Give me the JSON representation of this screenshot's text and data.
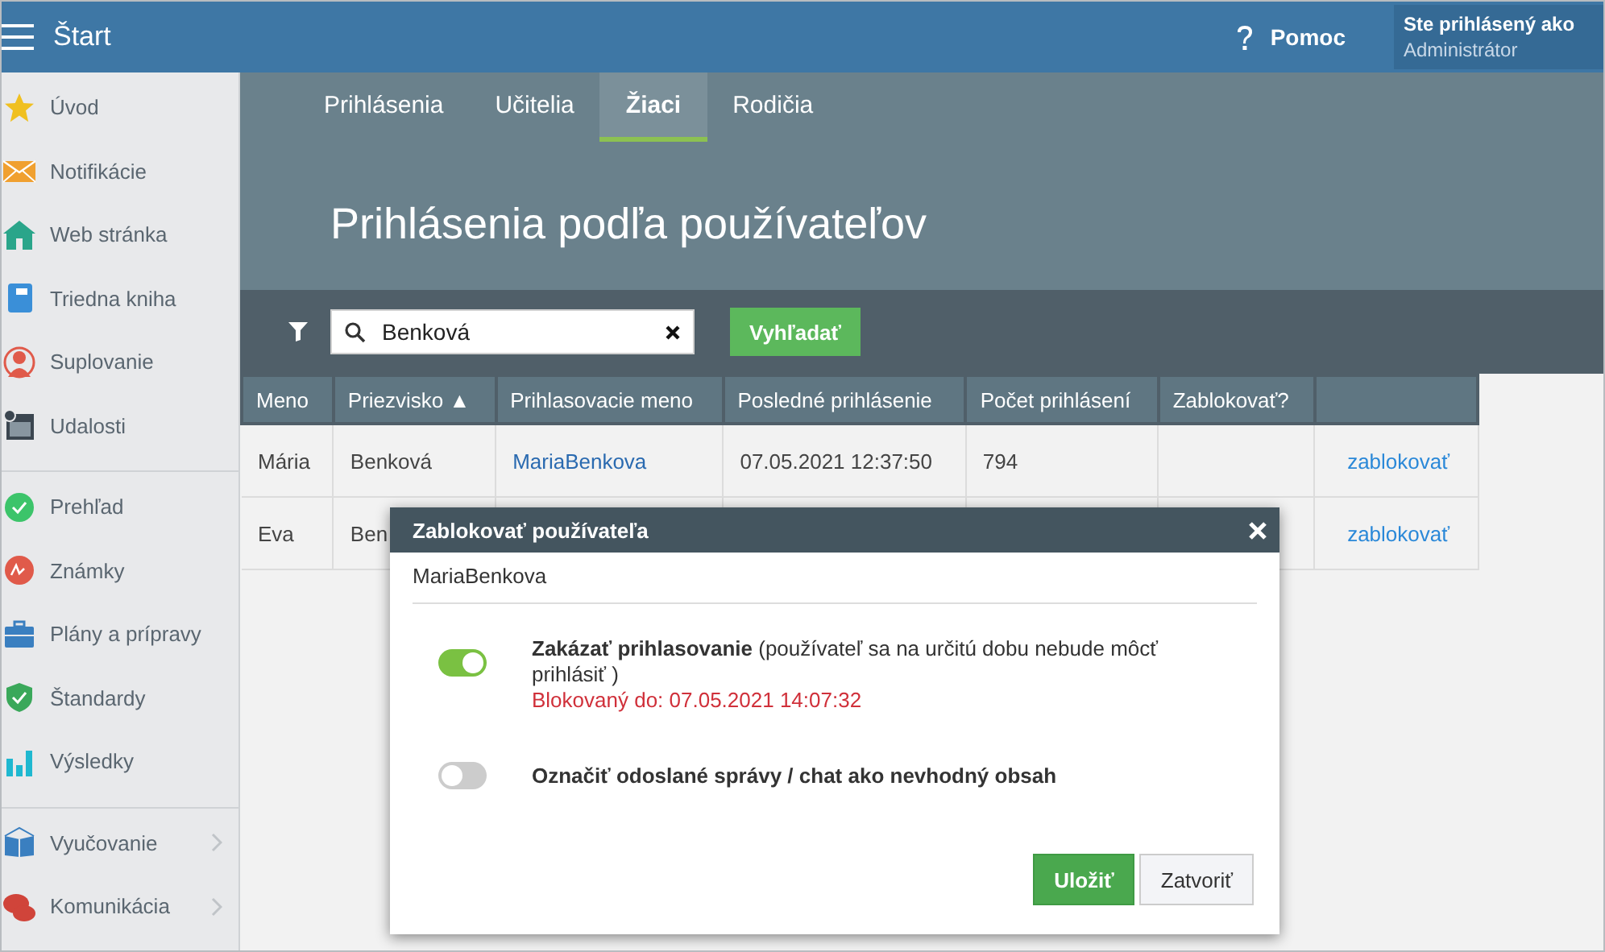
{
  "topbar": {
    "menu_label": "Štart",
    "help": "Pomoc",
    "user_caption": "Ste prihlásený ako",
    "user_role": "Administrátor"
  },
  "sidebar": {
    "groups": [
      {
        "items": [
          {
            "kind": "star",
            "label": "Úvod",
            "expandable": false
          },
          {
            "kind": "envelope",
            "label": "Notifikácie",
            "expandable": false
          },
          {
            "kind": "house",
            "label": "Web stránka",
            "expandable": false
          },
          {
            "kind": "notebook",
            "label": "Triedna kniha",
            "expandable": false
          },
          {
            "kind": "person",
            "label": "Suplovanie",
            "expandable": false
          },
          {
            "kind": "calendar",
            "label": "Udalosti",
            "expandable": false
          }
        ]
      },
      {
        "items": [
          {
            "kind": "check",
            "label": "Prehľad",
            "expandable": false
          },
          {
            "kind": "grade",
            "label": "Známky",
            "expandable": false
          },
          {
            "kind": "briefcase",
            "label": "Plány a prípravy",
            "expandable": false
          },
          {
            "kind": "shield",
            "label": "Štandardy",
            "expandable": false
          },
          {
            "kind": "bars",
            "label": "Výsledky",
            "expandable": false
          }
        ]
      },
      {
        "items": [
          {
            "kind": "openbook",
            "label": "Vyučovanie",
            "expandable": true
          },
          {
            "kind": "chat",
            "label": "Komunikácia",
            "expandable": true
          }
        ]
      }
    ]
  },
  "tabs": [
    {
      "label": "Prihlásenia",
      "selected": false
    },
    {
      "label": "Učitelia",
      "selected": false
    },
    {
      "label": "Žiaci",
      "selected": true
    },
    {
      "label": "Rodičia",
      "selected": false
    }
  ],
  "page_title": "Prihlásenia podľa používateľov",
  "search": {
    "value": "Benková",
    "button": "Vyhľadať"
  },
  "table": {
    "columns": [
      "Meno",
      "Priezvisko ▲",
      "Prihlasovacie meno",
      "Posledné prihlásenie",
      "Počet prihlásení",
      "Zablokovať?"
    ],
    "rows": [
      {
        "first_name": "Mária",
        "last_name": "Benková",
        "login": "MariaBenkova",
        "last_login": "07.05.2021 12:37:50",
        "count": "794",
        "action": "zablokovať"
      },
      {
        "first_name": "Eva",
        "last_name": "Ben",
        "action": "zablokovať"
      }
    ]
  },
  "dialog": {
    "title": "Zablokovať používateľa",
    "username": "MariaBenkova",
    "options": [
      {
        "on": true,
        "bold": false,
        "text": "**Zakázať prihlasovanie** (používateľ sa na určitú dobu nebude môcť prihlásiť )",
        "status": "Blokovaný do: 07.05.2021 14:07:32"
      },
      {
        "on": false,
        "bold": true,
        "text": "Označiť odoslané správy / chat ako nevhodný obsah"
      }
    ],
    "buttons": [
      {
        "kind": "primary",
        "label": "Uložiť"
      },
      {
        "kind": "default",
        "label": "Zatvoriť"
      }
    ]
  }
}
